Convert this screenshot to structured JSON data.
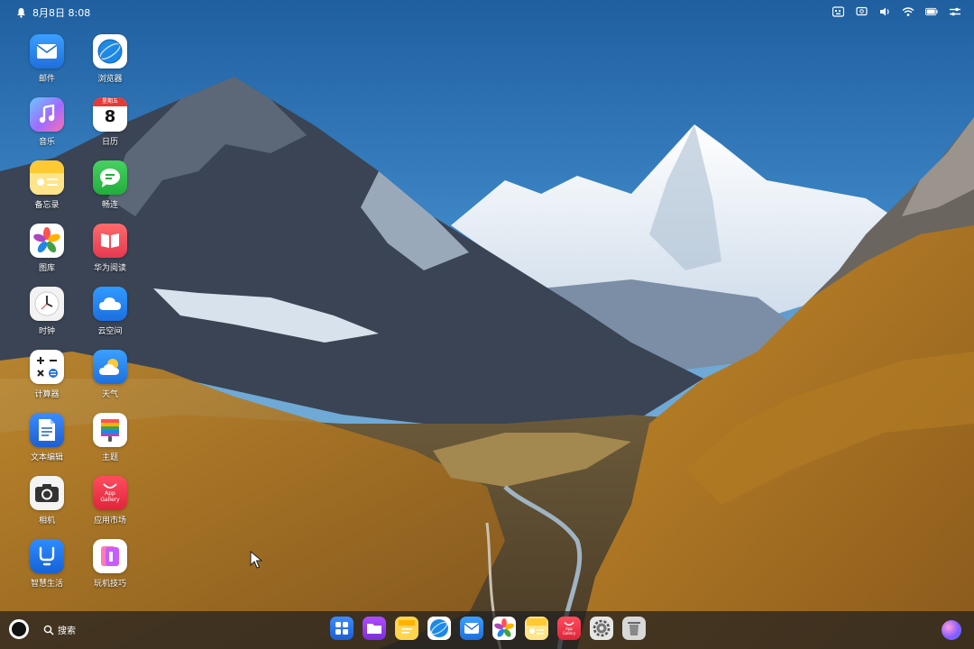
{
  "status_bar": {
    "date_time": "8月8日 8:08",
    "icons": [
      "bell-icon",
      "keyboard-icon",
      "screen-cast-icon",
      "volume-icon",
      "wifi-icon",
      "battery-icon",
      "control-center-icon"
    ]
  },
  "desktop": {
    "apps": [
      {
        "label": "邮件",
        "icon": "mail-icon"
      },
      {
        "label": "浏览器",
        "icon": "browser-icon"
      },
      {
        "label": "音乐",
        "icon": "music-icon"
      },
      {
        "label": "日历",
        "icon": "calendar-icon",
        "calendar_weekday": "星期五",
        "calendar_day": "8"
      },
      {
        "label": "备忘录",
        "icon": "notes-icon"
      },
      {
        "label": "畅连",
        "icon": "meetime-icon"
      },
      {
        "label": "图库",
        "icon": "gallery-icon"
      },
      {
        "label": "华为阅读",
        "icon": "books-icon"
      },
      {
        "label": "时钟",
        "icon": "clock-icon"
      },
      {
        "label": "云空间",
        "icon": "cloud-icon"
      },
      {
        "label": "计算器",
        "icon": "calculator-icon"
      },
      {
        "label": "天气",
        "icon": "weather-icon"
      },
      {
        "label": "文本编辑",
        "icon": "text-editor-icon"
      },
      {
        "label": "主题",
        "icon": "themes-icon"
      },
      {
        "label": "相机",
        "icon": "camera-icon"
      },
      {
        "label": "应用市场",
        "icon": "appgallery-icon",
        "icon_text": "App Gallery"
      },
      {
        "label": "智慧生活",
        "icon": "ai-life-icon"
      },
      {
        "label": "玩机技巧",
        "icon": "tips-icon"
      }
    ]
  },
  "taskbar": {
    "search_label": "搜索",
    "dock": [
      {
        "icon": "app-center-icon"
      },
      {
        "icon": "file-manager-icon"
      },
      {
        "icon": "notes-icon"
      },
      {
        "icon": "browser-icon"
      },
      {
        "icon": "mail-icon"
      },
      {
        "icon": "gallery-icon"
      },
      {
        "icon": "memo-icon"
      },
      {
        "icon": "appgallery-icon",
        "icon_text": "App Gallery"
      },
      {
        "icon": "settings-icon"
      },
      {
        "icon": "trash-icon"
      }
    ]
  },
  "colors": {
    "sky": "#2f6fa8",
    "taskbar": "#1e1e20",
    "accent_blue": "#1f7ae0"
  }
}
